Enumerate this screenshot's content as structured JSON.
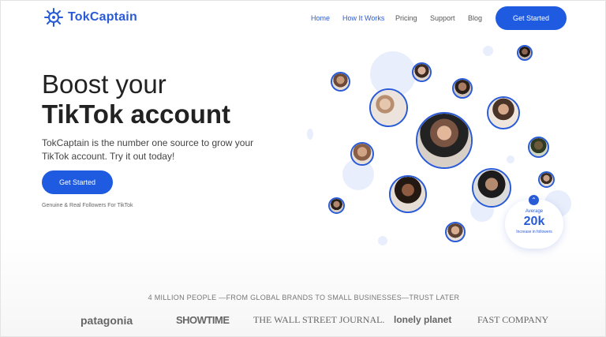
{
  "header": {
    "brand": "TokCaptain",
    "nav": [
      "Home",
      "How It Works",
      "Pricing",
      "Support",
      "Blog"
    ],
    "cta": "Get Started"
  },
  "hero": {
    "title_line1": "Boost your",
    "title_line2": "TikTok account",
    "subtitle": "TokCaptain is the number one source to grow your TikTok account. Try it out today!",
    "cta": "Get Started",
    "note": "Genuine & Real Followers For TikTok"
  },
  "stat": {
    "label": "Average",
    "value": "20k",
    "desc": "Increase in followers"
  },
  "trust": {
    "headline": "4 MILLION PEOPLE —FROM GLOBAL BRANDS TO SMALL BUSINESSES—TRUST LATER",
    "brands": [
      "patagonia",
      "SHOWTIME",
      "THE WALL STREET JOURNAL.",
      "lonely planet",
      "FAST COMPANY"
    ]
  },
  "colors": {
    "accent": "#1e5be0",
    "brand_text": "#2a5bd7"
  },
  "icons": [
    "ship-wheel-icon",
    "arrow-up-icon"
  ]
}
